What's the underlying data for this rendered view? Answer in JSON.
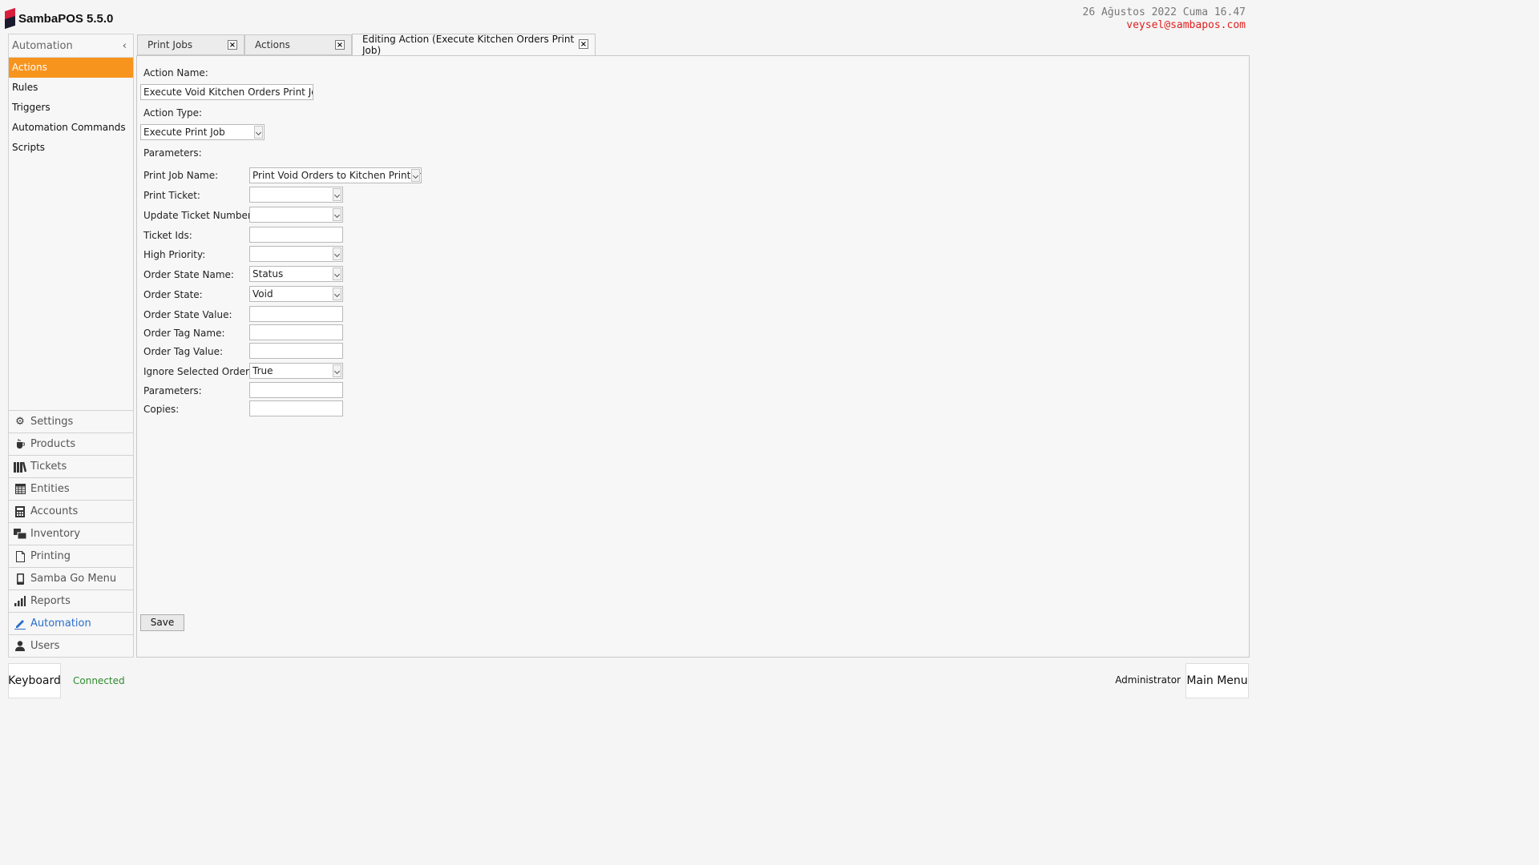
{
  "app": {
    "title": "SambaPOS 5.5.0"
  },
  "clock": {
    "datetime": "26 Ağustos 2022 Cuma 16.47",
    "user_email": "veysel@sambapos.com"
  },
  "sidebar": {
    "header": "Automation",
    "items": [
      {
        "label": "Actions",
        "active": true
      },
      {
        "label": "Rules"
      },
      {
        "label": "Triggers"
      },
      {
        "label": "Automation Commands"
      },
      {
        "label": "Scripts"
      }
    ],
    "nav": [
      {
        "label": "Settings",
        "icon": "gear-icon"
      },
      {
        "label": "Products",
        "icon": "coffee-cup-icon"
      },
      {
        "label": "Tickets",
        "icon": "tickets-icon"
      },
      {
        "label": "Entities",
        "icon": "table-grid-icon"
      },
      {
        "label": "Accounts",
        "icon": "calculator-icon"
      },
      {
        "label": "Inventory",
        "icon": "boxes-icon"
      },
      {
        "label": "Printing",
        "icon": "document-icon"
      },
      {
        "label": "Samba Go Menu",
        "icon": "phone-icon"
      },
      {
        "label": "Reports",
        "icon": "bar-chart-icon"
      },
      {
        "label": "Automation",
        "icon": "pencil-icon",
        "active": true
      },
      {
        "label": "Users",
        "icon": "user-icon"
      }
    ]
  },
  "tabs": [
    {
      "label": "Print Jobs"
    },
    {
      "label": "Actions"
    },
    {
      "label": "Editing Action (Execute Kitchen Orders Print Job)",
      "active": true
    }
  ],
  "form": {
    "action_name_label": "Action Name:",
    "action_name_value": "Execute Void Kitchen Orders Print Job",
    "action_type_label": "Action Type:",
    "action_type_value": "Execute Print Job",
    "parameters_header": "Parameters:",
    "params": [
      {
        "label": "Print Job Name:",
        "type": "dropdown",
        "value": "Print Void Orders to Kitchen Printer"
      },
      {
        "label": "Print Ticket:",
        "type": "dropdown",
        "value": ""
      },
      {
        "label": "Update Ticket Number:",
        "type": "dropdown",
        "value": ""
      },
      {
        "label": "Ticket Ids:",
        "type": "text",
        "value": ""
      },
      {
        "label": "High Priority:",
        "type": "dropdown",
        "value": ""
      },
      {
        "label": "Order State Name:",
        "type": "dropdown",
        "value": "Status"
      },
      {
        "label": "Order State:",
        "type": "dropdown",
        "value": "Void"
      },
      {
        "label": "Order State Value:",
        "type": "text",
        "value": ""
      },
      {
        "label": "Order Tag Name:",
        "type": "text",
        "value": ""
      },
      {
        "label": "Order Tag Value:",
        "type": "text",
        "value": ""
      },
      {
        "label": "Ignore Selected Orders:",
        "type": "dropdown",
        "value": "True"
      },
      {
        "label": "Parameters:",
        "type": "text",
        "value": ""
      },
      {
        "label": "Copies:",
        "type": "text",
        "value": ""
      }
    ],
    "save_label": "Save"
  },
  "footer": {
    "keyboard_label": "Keyboard",
    "status": "Connected",
    "user": "Administrator",
    "main_menu_label": "Main Menu"
  },
  "colors": {
    "accent": "#f7941d",
    "connected": "#2e8b2e",
    "email": "#e02020",
    "active_nav": "#2a6fc9"
  }
}
